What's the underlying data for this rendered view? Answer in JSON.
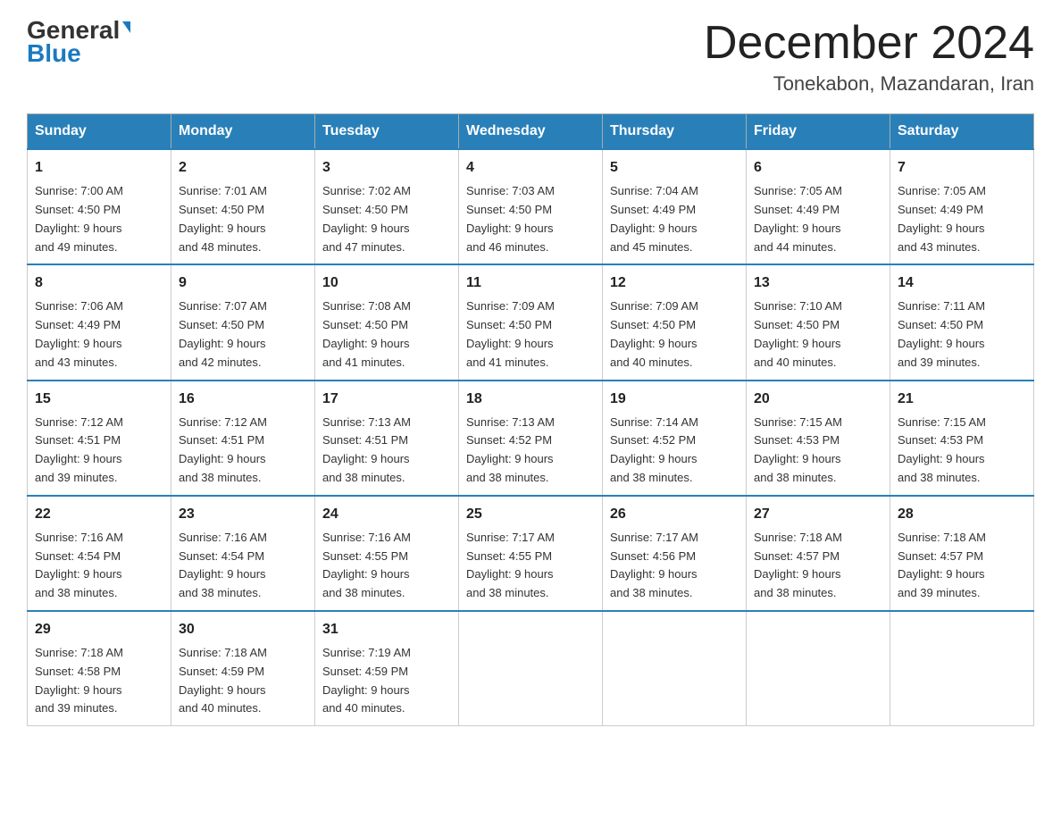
{
  "header": {
    "logo_part1": "General",
    "logo_part2": "Blue",
    "title": "December 2024",
    "subtitle": "Tonekabon, Mazandaran, Iran"
  },
  "weekdays": [
    "Sunday",
    "Monday",
    "Tuesday",
    "Wednesday",
    "Thursday",
    "Friday",
    "Saturday"
  ],
  "weeks": [
    [
      {
        "day": "1",
        "sunrise": "Sunrise: 7:00 AM",
        "sunset": "Sunset: 4:50 PM",
        "daylight1": "Daylight: 9 hours",
        "daylight2": "and 49 minutes."
      },
      {
        "day": "2",
        "sunrise": "Sunrise: 7:01 AM",
        "sunset": "Sunset: 4:50 PM",
        "daylight1": "Daylight: 9 hours",
        "daylight2": "and 48 minutes."
      },
      {
        "day": "3",
        "sunrise": "Sunrise: 7:02 AM",
        "sunset": "Sunset: 4:50 PM",
        "daylight1": "Daylight: 9 hours",
        "daylight2": "and 47 minutes."
      },
      {
        "day": "4",
        "sunrise": "Sunrise: 7:03 AM",
        "sunset": "Sunset: 4:50 PM",
        "daylight1": "Daylight: 9 hours",
        "daylight2": "and 46 minutes."
      },
      {
        "day": "5",
        "sunrise": "Sunrise: 7:04 AM",
        "sunset": "Sunset: 4:49 PM",
        "daylight1": "Daylight: 9 hours",
        "daylight2": "and 45 minutes."
      },
      {
        "day": "6",
        "sunrise": "Sunrise: 7:05 AM",
        "sunset": "Sunset: 4:49 PM",
        "daylight1": "Daylight: 9 hours",
        "daylight2": "and 44 minutes."
      },
      {
        "day": "7",
        "sunrise": "Sunrise: 7:05 AM",
        "sunset": "Sunset: 4:49 PM",
        "daylight1": "Daylight: 9 hours",
        "daylight2": "and 43 minutes."
      }
    ],
    [
      {
        "day": "8",
        "sunrise": "Sunrise: 7:06 AM",
        "sunset": "Sunset: 4:49 PM",
        "daylight1": "Daylight: 9 hours",
        "daylight2": "and 43 minutes."
      },
      {
        "day": "9",
        "sunrise": "Sunrise: 7:07 AM",
        "sunset": "Sunset: 4:50 PM",
        "daylight1": "Daylight: 9 hours",
        "daylight2": "and 42 minutes."
      },
      {
        "day": "10",
        "sunrise": "Sunrise: 7:08 AM",
        "sunset": "Sunset: 4:50 PM",
        "daylight1": "Daylight: 9 hours",
        "daylight2": "and 41 minutes."
      },
      {
        "day": "11",
        "sunrise": "Sunrise: 7:09 AM",
        "sunset": "Sunset: 4:50 PM",
        "daylight1": "Daylight: 9 hours",
        "daylight2": "and 41 minutes."
      },
      {
        "day": "12",
        "sunrise": "Sunrise: 7:09 AM",
        "sunset": "Sunset: 4:50 PM",
        "daylight1": "Daylight: 9 hours",
        "daylight2": "and 40 minutes."
      },
      {
        "day": "13",
        "sunrise": "Sunrise: 7:10 AM",
        "sunset": "Sunset: 4:50 PM",
        "daylight1": "Daylight: 9 hours",
        "daylight2": "and 40 minutes."
      },
      {
        "day": "14",
        "sunrise": "Sunrise: 7:11 AM",
        "sunset": "Sunset: 4:50 PM",
        "daylight1": "Daylight: 9 hours",
        "daylight2": "and 39 minutes."
      }
    ],
    [
      {
        "day": "15",
        "sunrise": "Sunrise: 7:12 AM",
        "sunset": "Sunset: 4:51 PM",
        "daylight1": "Daylight: 9 hours",
        "daylight2": "and 39 minutes."
      },
      {
        "day": "16",
        "sunrise": "Sunrise: 7:12 AM",
        "sunset": "Sunset: 4:51 PM",
        "daylight1": "Daylight: 9 hours",
        "daylight2": "and 38 minutes."
      },
      {
        "day": "17",
        "sunrise": "Sunrise: 7:13 AM",
        "sunset": "Sunset: 4:51 PM",
        "daylight1": "Daylight: 9 hours",
        "daylight2": "and 38 minutes."
      },
      {
        "day": "18",
        "sunrise": "Sunrise: 7:13 AM",
        "sunset": "Sunset: 4:52 PM",
        "daylight1": "Daylight: 9 hours",
        "daylight2": "and 38 minutes."
      },
      {
        "day": "19",
        "sunrise": "Sunrise: 7:14 AM",
        "sunset": "Sunset: 4:52 PM",
        "daylight1": "Daylight: 9 hours",
        "daylight2": "and 38 minutes."
      },
      {
        "day": "20",
        "sunrise": "Sunrise: 7:15 AM",
        "sunset": "Sunset: 4:53 PM",
        "daylight1": "Daylight: 9 hours",
        "daylight2": "and 38 minutes."
      },
      {
        "day": "21",
        "sunrise": "Sunrise: 7:15 AM",
        "sunset": "Sunset: 4:53 PM",
        "daylight1": "Daylight: 9 hours",
        "daylight2": "and 38 minutes."
      }
    ],
    [
      {
        "day": "22",
        "sunrise": "Sunrise: 7:16 AM",
        "sunset": "Sunset: 4:54 PM",
        "daylight1": "Daylight: 9 hours",
        "daylight2": "and 38 minutes."
      },
      {
        "day": "23",
        "sunrise": "Sunrise: 7:16 AM",
        "sunset": "Sunset: 4:54 PM",
        "daylight1": "Daylight: 9 hours",
        "daylight2": "and 38 minutes."
      },
      {
        "day": "24",
        "sunrise": "Sunrise: 7:16 AM",
        "sunset": "Sunset: 4:55 PM",
        "daylight1": "Daylight: 9 hours",
        "daylight2": "and 38 minutes."
      },
      {
        "day": "25",
        "sunrise": "Sunrise: 7:17 AM",
        "sunset": "Sunset: 4:55 PM",
        "daylight1": "Daylight: 9 hours",
        "daylight2": "and 38 minutes."
      },
      {
        "day": "26",
        "sunrise": "Sunrise: 7:17 AM",
        "sunset": "Sunset: 4:56 PM",
        "daylight1": "Daylight: 9 hours",
        "daylight2": "and 38 minutes."
      },
      {
        "day": "27",
        "sunrise": "Sunrise: 7:18 AM",
        "sunset": "Sunset: 4:57 PM",
        "daylight1": "Daylight: 9 hours",
        "daylight2": "and 38 minutes."
      },
      {
        "day": "28",
        "sunrise": "Sunrise: 7:18 AM",
        "sunset": "Sunset: 4:57 PM",
        "daylight1": "Daylight: 9 hours",
        "daylight2": "and 39 minutes."
      }
    ],
    [
      {
        "day": "29",
        "sunrise": "Sunrise: 7:18 AM",
        "sunset": "Sunset: 4:58 PM",
        "daylight1": "Daylight: 9 hours",
        "daylight2": "and 39 minutes."
      },
      {
        "day": "30",
        "sunrise": "Sunrise: 7:18 AM",
        "sunset": "Sunset: 4:59 PM",
        "daylight1": "Daylight: 9 hours",
        "daylight2": "and 40 minutes."
      },
      {
        "day": "31",
        "sunrise": "Sunrise: 7:19 AM",
        "sunset": "Sunset: 4:59 PM",
        "daylight1": "Daylight: 9 hours",
        "daylight2": "and 40 minutes."
      },
      {
        "day": "",
        "sunrise": "",
        "sunset": "",
        "daylight1": "",
        "daylight2": ""
      },
      {
        "day": "",
        "sunrise": "",
        "sunset": "",
        "daylight1": "",
        "daylight2": ""
      },
      {
        "day": "",
        "sunrise": "",
        "sunset": "",
        "daylight1": "",
        "daylight2": ""
      },
      {
        "day": "",
        "sunrise": "",
        "sunset": "",
        "daylight1": "",
        "daylight2": ""
      }
    ]
  ]
}
